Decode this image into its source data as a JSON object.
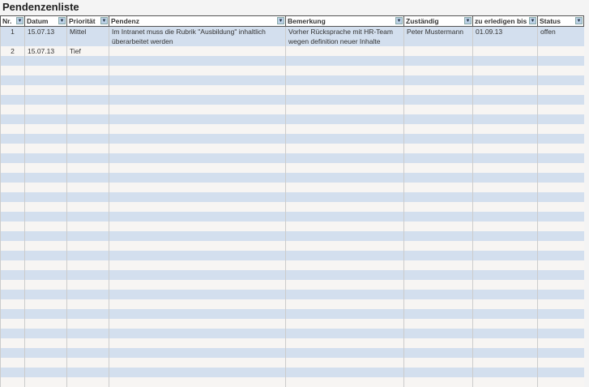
{
  "title": "Pendenzenliste",
  "columns": [
    "Nr.",
    "Datum",
    "Priorität",
    "Pendenz",
    "Bemerkung",
    "Zuständig",
    "zu erledigen bis",
    "Status"
  ],
  "rows": [
    {
      "nr": "1",
      "datum": "15.07.13",
      "prioritaet": "Mittel",
      "pendenz": "Im Intranet muss die Rubrik \"Ausbildung\" inhaltlich überarbeitet werden",
      "bemerkung": "Vorher Rücksprache mit HR-Team wegen definition neuer Inhalte",
      "zustaendig": "Peter Mustermann",
      "bis": "01.09.13",
      "status": "offen"
    },
    {
      "nr": "2",
      "datum": "15.07.13",
      "prioritaet": "Tief",
      "pendenz": "",
      "bemerkung": "",
      "zustaendig": "",
      "bis": "",
      "status": ""
    }
  ],
  "colors": {
    "band": "#d3dfee",
    "light": "#f7f5f3"
  }
}
